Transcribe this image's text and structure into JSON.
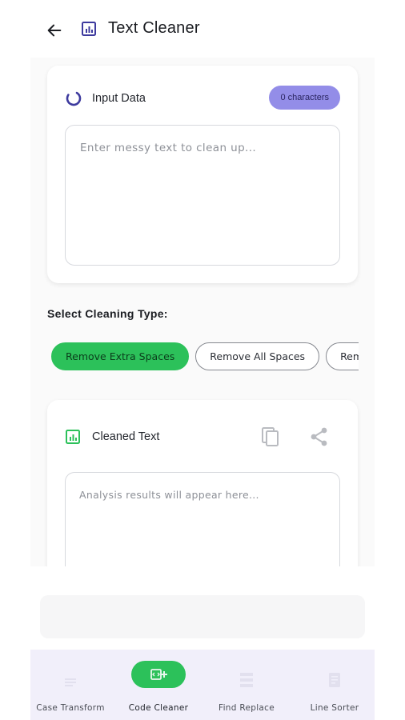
{
  "header": {
    "title": "Text Cleaner",
    "back_icon": "arrow-left-icon",
    "title_icon": "chart-document-icon"
  },
  "input_card": {
    "label": "Input Data",
    "icon": "loading-ring-icon",
    "char_count": "0 characters",
    "placeholder": "Enter messy text to clean up...",
    "value": ""
  },
  "cleaning": {
    "section_label": "Select Cleaning Type:",
    "options": [
      {
        "label": "Remove Extra Spaces",
        "selected": true
      },
      {
        "label": "Remove All Spaces",
        "selected": false
      },
      {
        "label": "Rem",
        "selected": false
      }
    ]
  },
  "output_card": {
    "label": "Cleaned Text",
    "icon": "chart-document-icon",
    "copy_icon": "copy-icon",
    "share_icon": "share-icon",
    "placeholder": "Analysis results will appear here..."
  },
  "bottom_nav": {
    "items": [
      {
        "label": "Case Transform",
        "icon": "text-lines-icon",
        "active": false
      },
      {
        "label": "Code Cleaner",
        "icon": "code-plus-icon",
        "active": true
      },
      {
        "label": "Find Replace",
        "icon": "list-icon",
        "active": false
      },
      {
        "label": "Line Sorter",
        "icon": "sort-lines-icon",
        "active": false
      }
    ]
  },
  "colors": {
    "accent_green": "#2cc15a",
    "badge_purple": "#938de8",
    "title_icon_blue": "#3d3a9e",
    "nav_background": "#f1effa"
  }
}
